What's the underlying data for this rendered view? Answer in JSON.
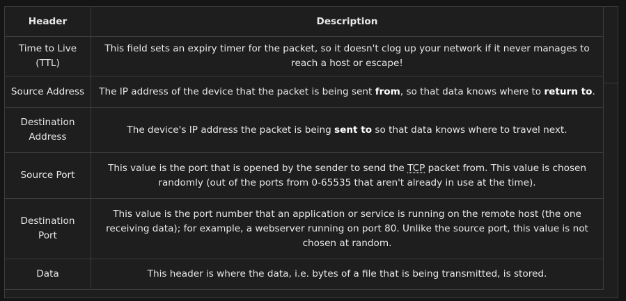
{
  "table": {
    "columns": [
      "Header",
      "Description"
    ],
    "rows": [
      {
        "header": "Time to Live (TTL)",
        "description": "This field sets an expiry timer for the packet, so it doesn't clog up your network if it never manages to reach a host or escape!"
      },
      {
        "header": "Source Address",
        "desc_parts": [
          "The IP address of the device that the packet is being sent ",
          "from",
          ", so that data knows where to ",
          "return to",
          "."
        ]
      },
      {
        "header": "Destination Address",
        "desc_parts": [
          "The device's IP address the packet is being ",
          "sent to",
          " so that data knows where to travel next."
        ]
      },
      {
        "header": "Source Port",
        "desc_parts": [
          "This value is the port that is opened by the sender to send the ",
          "TCP",
          " packet from. This value is chosen randomly (out of the ports from 0-65535 that aren't already in use at the time)."
        ]
      },
      {
        "header": "Destination Port",
        "description": "This value is the port number that an application or service is running on the remote host (the one receiving data); for example, a webserver running on port 80. Unlike the source port, this value is not chosen at random."
      },
      {
        "header": "Data",
        "description": "This header is where the data, i.e. bytes of a file that is being transmitted, is stored."
      }
    ]
  }
}
